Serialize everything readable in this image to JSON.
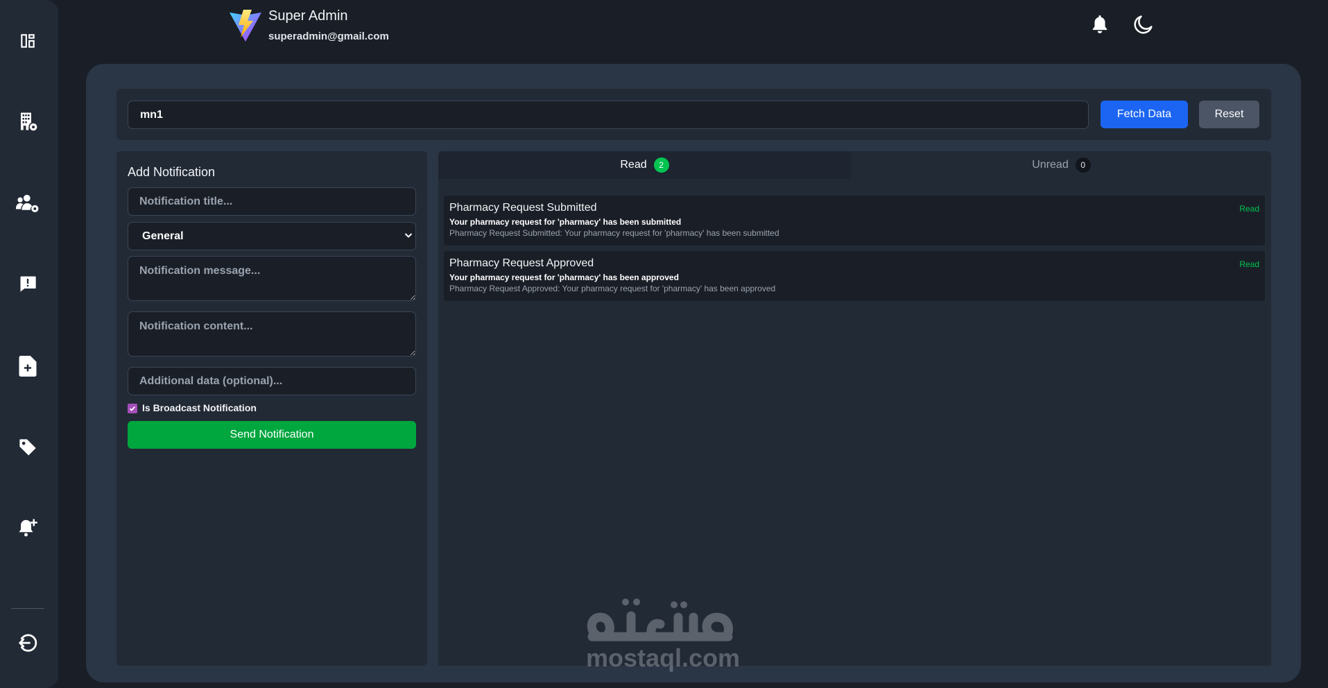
{
  "sidebar": {
    "items": [
      {
        "icon": "dashboard-icon"
      },
      {
        "icon": "building-gear-icon"
      },
      {
        "icon": "users-gear-icon"
      },
      {
        "icon": "message-alert-icon"
      },
      {
        "icon": "file-plus-icon"
      },
      {
        "icon": "tag-icon"
      },
      {
        "icon": "bell-plus-icon"
      }
    ],
    "logout_icon": "logout-icon"
  },
  "header": {
    "name": "Super Admin",
    "email": "superadmin@gmail.com",
    "logo_icon": "vite-logo-icon",
    "actions": [
      "bell-icon",
      "moon-icon"
    ]
  },
  "search": {
    "value": "mn1",
    "fetch_label": "Fetch Data",
    "reset_label": "Reset"
  },
  "add_notification": {
    "title": "Add Notification",
    "title_placeholder": "Notification title...",
    "type_selected": "General",
    "message_placeholder": "Notification message...",
    "content_placeholder": "Notification content...",
    "data_placeholder": "Additional data (optional)...",
    "broadcast_label": "Is Broadcast Notification",
    "broadcast_checked": true,
    "send_label": "Send Notification"
  },
  "tabs": [
    {
      "label": "Read",
      "count": "2",
      "active": true
    },
    {
      "label": "Unread",
      "count": "0",
      "active": false
    }
  ],
  "notifications": [
    {
      "title": "Pharmacy Request Submitted",
      "message": "Your pharmacy request for 'pharmacy' has been submitted",
      "content": "Pharmacy Request Submitted: Your pharmacy request for 'pharmacy' has been submitted",
      "status": "Read"
    },
    {
      "title": "Pharmacy Request Approved",
      "message": "Your pharmacy request for 'pharmacy' has been approved",
      "content": "Pharmacy Request Approved: Your pharmacy request for 'pharmacy' has been approved",
      "status": "Read"
    }
  ],
  "watermark": {
    "arabic": "مستقل",
    "latin": "mostaql.com"
  },
  "colors": {
    "background": "#1a1f27",
    "panel": "#2a3545",
    "card": "#222a36",
    "primary": "#1c65f2",
    "success": "#00a63e",
    "status_read": "#00c451",
    "checkbox": "#a44fb8"
  }
}
